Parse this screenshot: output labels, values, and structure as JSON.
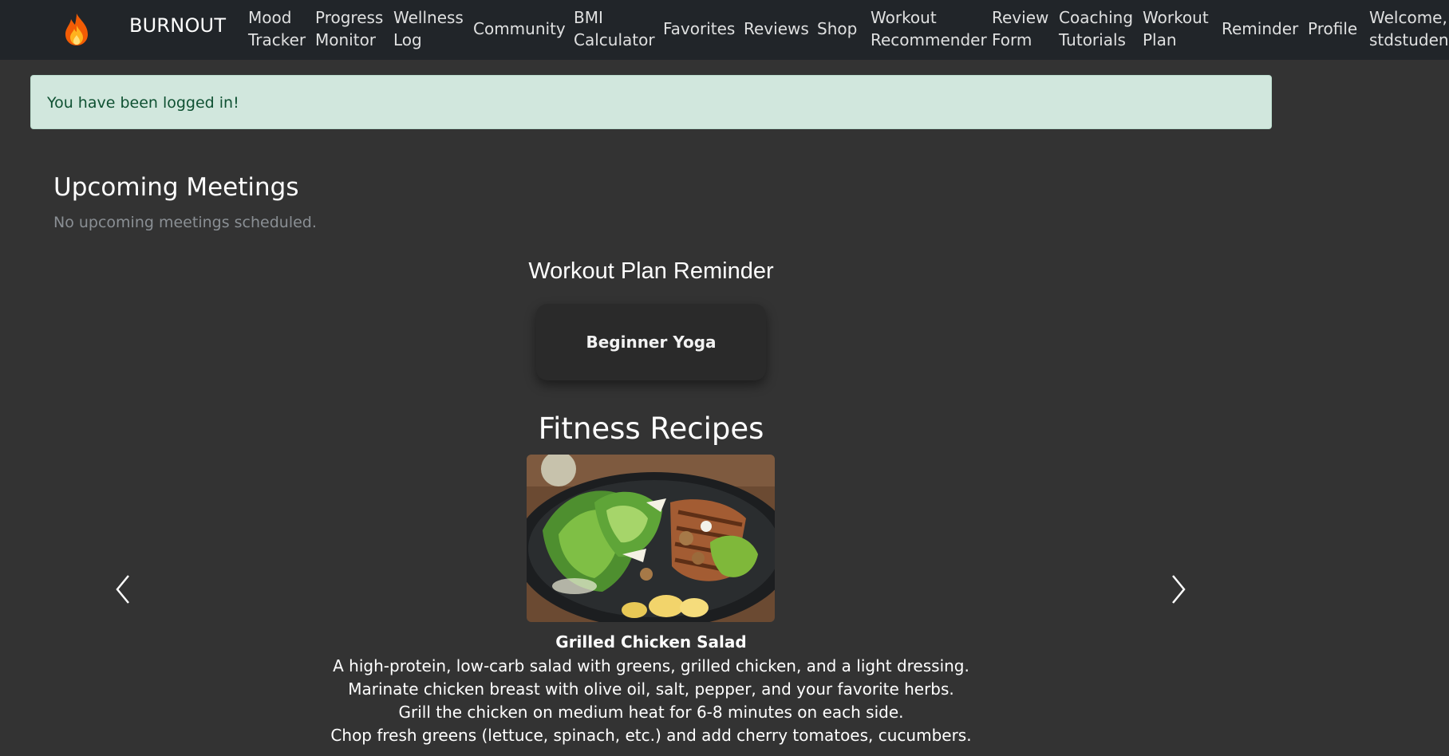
{
  "navbar": {
    "brand": "BURNOUT",
    "logo_icon": "flame-icon",
    "items": [
      {
        "label": "Mood\nTracker"
      },
      {
        "label": "Progress\nMonitor"
      },
      {
        "label": "Wellness\nLog"
      },
      {
        "label": "Community"
      },
      {
        "label": "BMI\nCalculator"
      },
      {
        "label": "Favorites"
      },
      {
        "label": "Reviews"
      },
      {
        "label": "Shop"
      },
      {
        "label": "Workout\nRecommender"
      },
      {
        "label": "Review\nForm"
      },
      {
        "label": "Coaching\nTutorials"
      },
      {
        "label": "Workout\nPlan"
      },
      {
        "label": "Reminder"
      },
      {
        "label": "Profile"
      },
      {
        "label": "Welcome,\nstdstudent"
      }
    ]
  },
  "alert": {
    "message": "You have been logged in!"
  },
  "meetings": {
    "title": "Upcoming Meetings",
    "empty_text": "No upcoming meetings scheduled."
  },
  "reminder": {
    "title": "Workout Plan Reminder",
    "plan_name": "Beginner Yoga"
  },
  "recipes": {
    "title": "Fitness Recipes",
    "current": {
      "name": "Grilled Chicken Salad",
      "lines": [
        "A high-protein, low-carb salad with greens, grilled chicken, and a light dressing.",
        "Marinate chicken breast with olive oil, salt, pepper, and your favorite herbs.",
        "Grill the chicken on medium heat for 6-8 minutes on each side.",
        "Chop fresh greens (lettuce, spinach, etc.) and add cherry tomatoes, cucumbers."
      ]
    },
    "prev_icon": "chevron-left-icon",
    "next_icon": "chevron-right-icon"
  },
  "colors": {
    "page_bg": "#333333",
    "navbar_bg": "#212529",
    "alert_bg": "#d1e7dd",
    "alert_text": "#0f5132",
    "card_bg": "#2a2a2a"
  }
}
